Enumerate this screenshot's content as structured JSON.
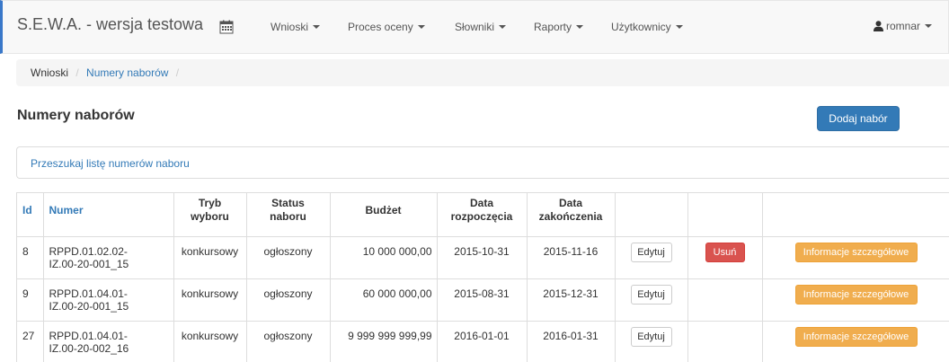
{
  "app": {
    "brand": "S.E.W.A. - wersja testowa",
    "calendar_icon": "calendar-icon",
    "accent_color": "#3a78c9"
  },
  "nav": {
    "items": [
      {
        "label": "Wnioski"
      },
      {
        "label": "Proces oceny"
      },
      {
        "label": "Słowniki"
      },
      {
        "label": "Raporty"
      },
      {
        "label": "Użytkownicy"
      }
    ],
    "user": {
      "label": "romnar",
      "icon": "user-icon"
    }
  },
  "breadcrumb": {
    "home": "Wnioski",
    "current": "Numery naborów",
    "separator": "/"
  },
  "page": {
    "title": "Numery naborów",
    "add_button": "Dodaj nabór",
    "search_label": "Przeszukaj listę numerów naboru"
  },
  "table": {
    "headers": {
      "id": "Id",
      "numer": "Numer",
      "tryb_line1": "Tryb",
      "tryb_line2": "wyboru",
      "status_line1": "Status",
      "status_line2": "naboru",
      "budzet": "Budżet",
      "start_line1": "Data",
      "start_line2": "rozpoczęcia",
      "end_line1": "Data",
      "end_line2": "zakończenia"
    },
    "rows": [
      {
        "id": "8",
        "numer_line1": "RPPD.01.02.02-",
        "numer_line2": "IZ.00-20-001_15",
        "tryb": "konkursowy",
        "status": "ogłoszony",
        "budzet": "10 000 000,00",
        "start": "2015-10-31",
        "end": "2015-11-16",
        "edit": "Edytuj",
        "delete": "Usuń",
        "info": "Informacje szczegółowe"
      },
      {
        "id": "9",
        "numer_line1": "RPPD.01.04.01-",
        "numer_line2": "IZ.00-20-001_15",
        "tryb": "konkursowy",
        "status": "ogłoszony",
        "budzet": "60 000 000,00",
        "start": "2015-08-31",
        "end": "2015-12-31",
        "edit": "Edytuj",
        "delete": "",
        "info": "Informacje szczegółowe"
      },
      {
        "id": "27",
        "numer_line1": "RPPD.01.04.01-",
        "numer_line2": "IZ.00-20-002_16",
        "tryb": "konkursowy",
        "status": "ogłoszony",
        "budzet": "9 999 999 999,99",
        "start": "2016-01-01",
        "end": "2016-01-31",
        "edit": "Edytuj",
        "delete": "",
        "info": "Informacje szczegółowe"
      }
    ]
  },
  "colors": {
    "link": "#337ab7",
    "primary": "#337ab7",
    "danger": "#d9534f",
    "warning": "#f0ad4e"
  }
}
